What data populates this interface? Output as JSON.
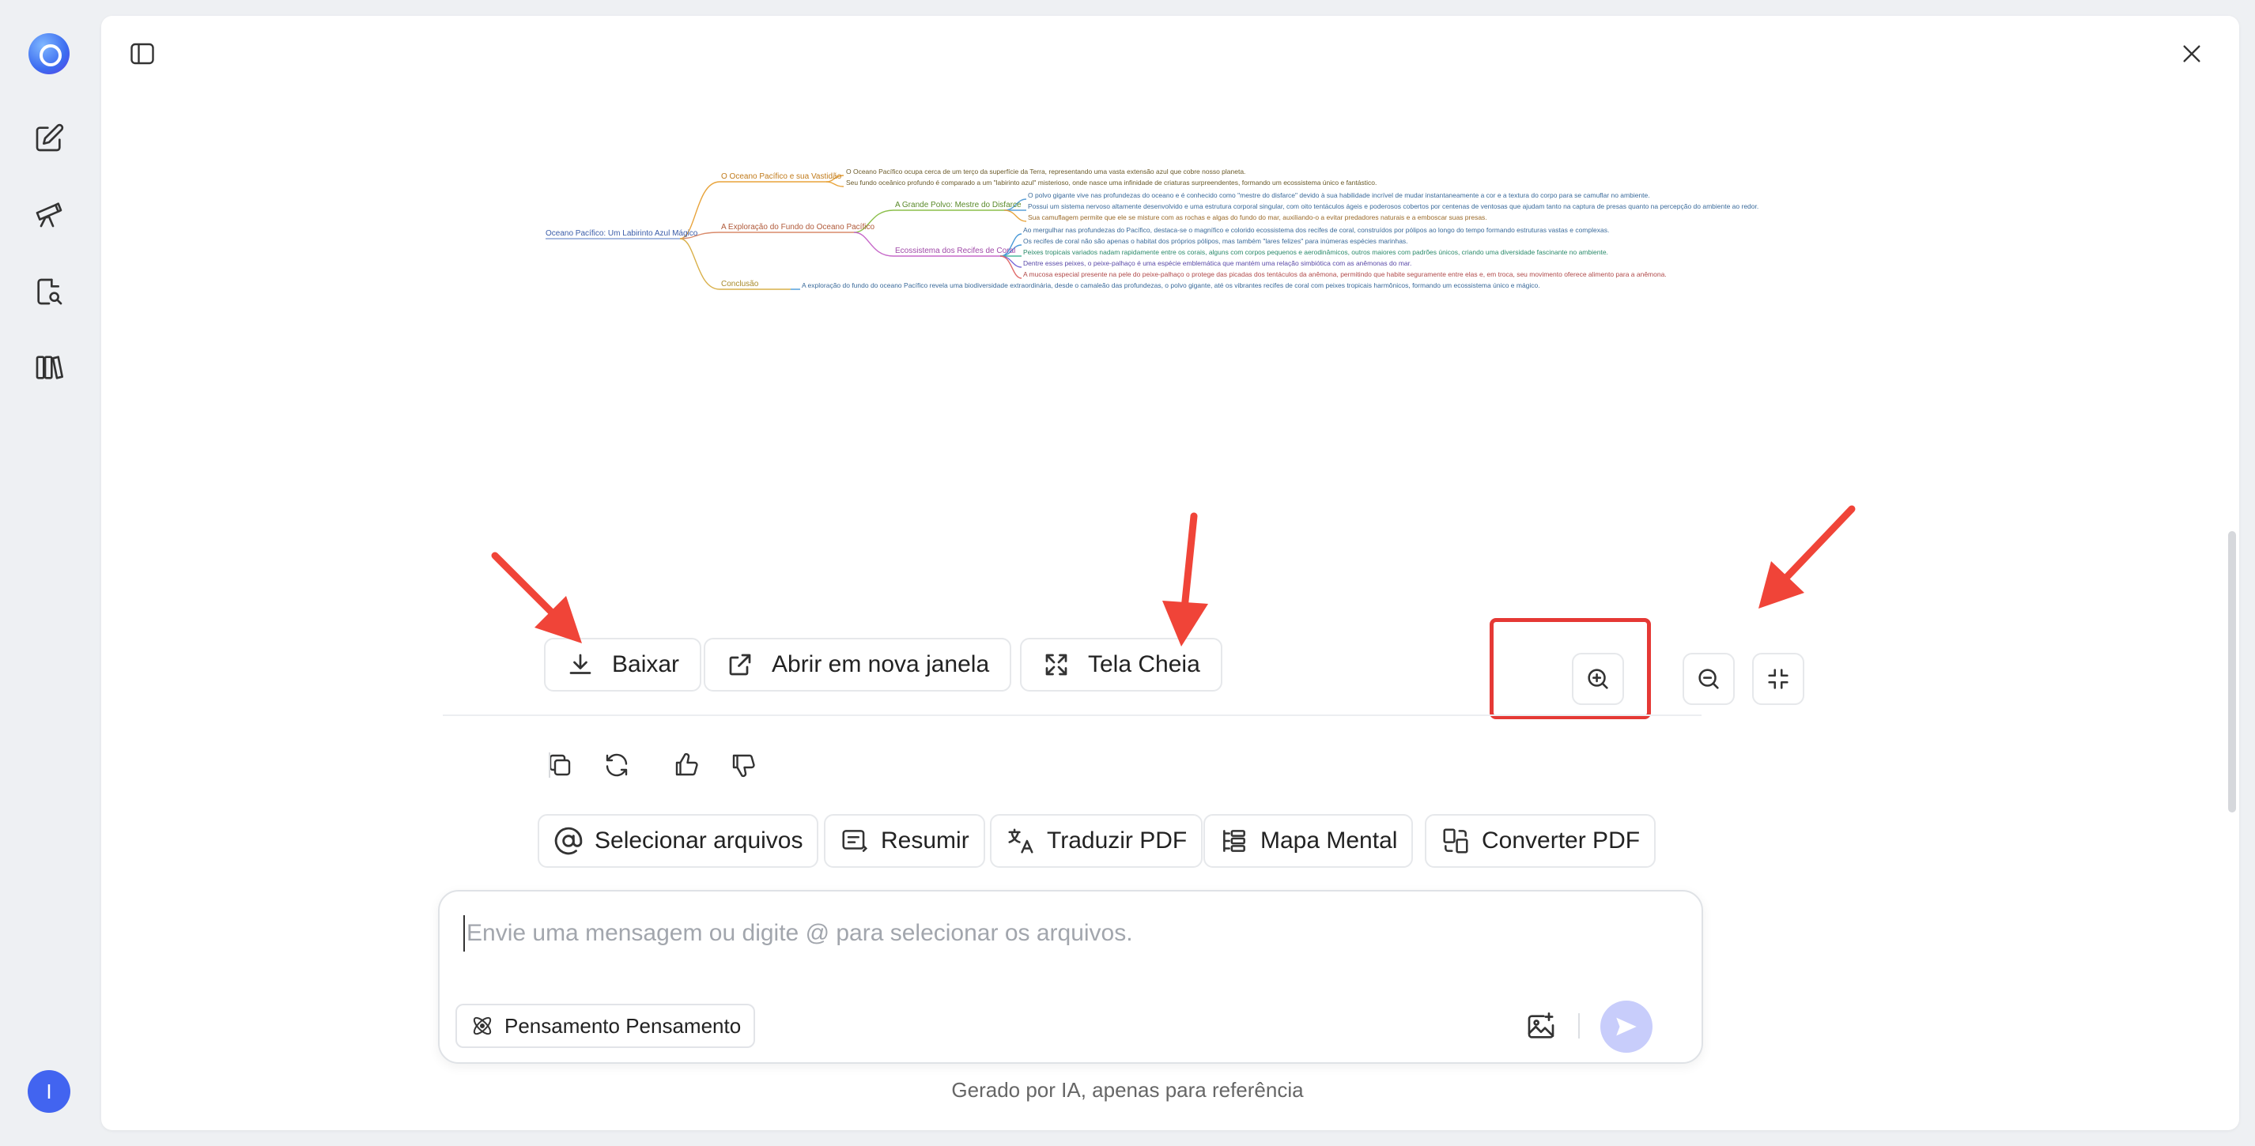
{
  "sidebar": {
    "items": [
      {
        "id": "new-chat",
        "icon": "edit-icon"
      },
      {
        "id": "telescope",
        "icon": "telescope-icon"
      },
      {
        "id": "doc-search",
        "icon": "document-search-icon"
      },
      {
        "id": "library",
        "icon": "books-icon"
      }
    ],
    "avatar_initial": "I"
  },
  "mindmap": {
    "root": "Oceano Pacífico: Um Labirinto Azul Mágico",
    "branches": [
      {
        "label": "O Oceano Pacífico e sua Vastidão",
        "color": "#e8a33a",
        "leaves": [
          "O Oceano Pacífico ocupa cerca de um terço da superfície da Terra, representando uma vasta extensão azul que cobre nosso planeta.",
          "Seu fundo oceânico profundo é comparado a um \"labirinto azul\" misterioso, onde nasce uma infinidade de criaturas surpreendentes, formando um ecossistema único e fantástico."
        ]
      },
      {
        "label": "A Exploração do Fundo do Oceano Pacífico",
        "color": "#d98a6a",
        "subbranches": [
          {
            "label": "A Grande Polvo: Mestre do Disfarce",
            "color": "#8bbf4a",
            "leaves": [
              "O polvo gigante vive nas profundezas do oceano e é conhecido como \"mestre do disfarce\" devido à sua habilidade incrível de mudar instantaneamente a cor e a textura do corpo para se camuflar no ambiente.",
              "Possui um sistema nervoso altamente desenvolvido e uma estrutura corporal singular, com oito tentáculos ágeis e poderosos cobertos por centenas de ventosas que ajudam tanto na captura de presas quanto na percepção do ambiente ao redor.",
              "Sua camuflagem permite que ele se misture com as rochas e algas do fundo do mar, auxiliando-o a evitar predadores naturais e a emboscar suas presas."
            ]
          },
          {
            "label": "Ecossistema dos Recifes de Coral",
            "color": "#c668c9",
            "leaves": [
              "Ao mergulhar nas profundezas do Pacífico, destaca-se o magnífico e colorido ecossistema dos recifes de coral, construídos por pólipos ao longo do tempo formando estruturas vastas e complexas.",
              "Os recifes de coral não são apenas o habitat dos próprios pólipos, mas também \"lares felizes\" para inúmeras espécies marinhas.",
              "Peixes tropicais variados nadam rapidamente entre os corais, alguns com corpos pequenos e aerodinâmicos, outros maiores com padrões únicos, criando uma diversidade fascinante no ambiente.",
              "Dentre esses peixes, o peixe-palhaço é uma espécie emblemática que mantém uma relação simbiótica com as anêmonas do mar.",
              "A mucosa especial presente na pele do peixe-palhaço o protege das picadas dos tentáculos da anêmona, permitindo que habite seguramente entre elas e, em troca, seu movimento oferece alimento para a anêmona."
            ]
          }
        ]
      },
      {
        "label": "Conclusão",
        "color": "#d9b04a",
        "leaves": [
          "A exploração do fundo do oceano Pacífico revela uma biodiversidade extraordinária, desde o camaleão das profundezas, o polvo gigante, até os vibrantes recifes de coral com peixes tropicais harmônicos, formando um ecossistema único e mágico."
        ]
      }
    ]
  },
  "toolbar": {
    "download_label": "Baixar",
    "open_window_label": "Abrir em nova janela",
    "fullscreen_label": "Tela Cheia"
  },
  "quick_actions": {
    "select_files": "Selecionar arquivos",
    "summarize": "Resumir",
    "translate_pdf": "Traduzir PDF",
    "mind_map": "Mapa Mental",
    "convert_pdf": "Converter PDF"
  },
  "composer": {
    "placeholder": "Envie uma mensagem ou digite @ para selecionar os arquivos.",
    "value": "",
    "thinking_label": "Pensamento Pensamento"
  },
  "footer": {
    "disclaimer": "Gerado por IA, apenas para referência"
  },
  "colors": {
    "accent": "#4264f0",
    "send_disabled": "#c8cdfb",
    "highlight": "#e53935",
    "annotation_arrow": "#f04438"
  }
}
